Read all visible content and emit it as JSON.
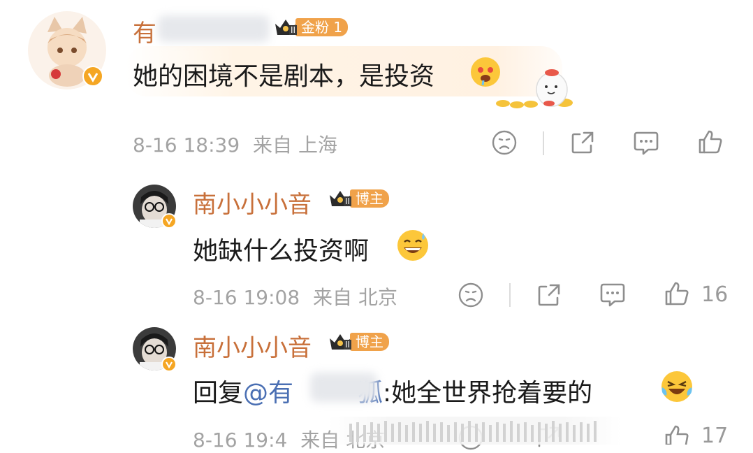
{
  "comment_1": {
    "username_visible": "有",
    "badge_label": "金粉 1",
    "badge_level": "II",
    "text": "她的困境不是剧本，是投资",
    "timestamp": "8-16 18:39",
    "location": "来自 上海"
  },
  "reply_1": {
    "username": "南小小小音",
    "badge_label": "博主",
    "badge_level": "II",
    "text": "她缺什么投资啊",
    "timestamp": "8-16 19:08",
    "location": "来自 北京",
    "like_count": "16"
  },
  "reply_2": {
    "username": "南小小小音",
    "badge_label": "博主",
    "badge_level": "II",
    "reply_prefix": "回复",
    "mention_start": "@有",
    "mention_end": "狐",
    "text": ":她全世界抢着要的",
    "timestamp": "8-16 19:4",
    "location": "来自 北京",
    "like_count": "17"
  },
  "icons": [
    "sad-face-icon",
    "share-icon",
    "comment-icon",
    "like-icon",
    "verified-icon",
    "crown-icon"
  ],
  "colors": {
    "username": "#c8703a",
    "badge": "#f0a24a",
    "mention": "#4a6fb3",
    "meta": "#a3a3a3"
  }
}
